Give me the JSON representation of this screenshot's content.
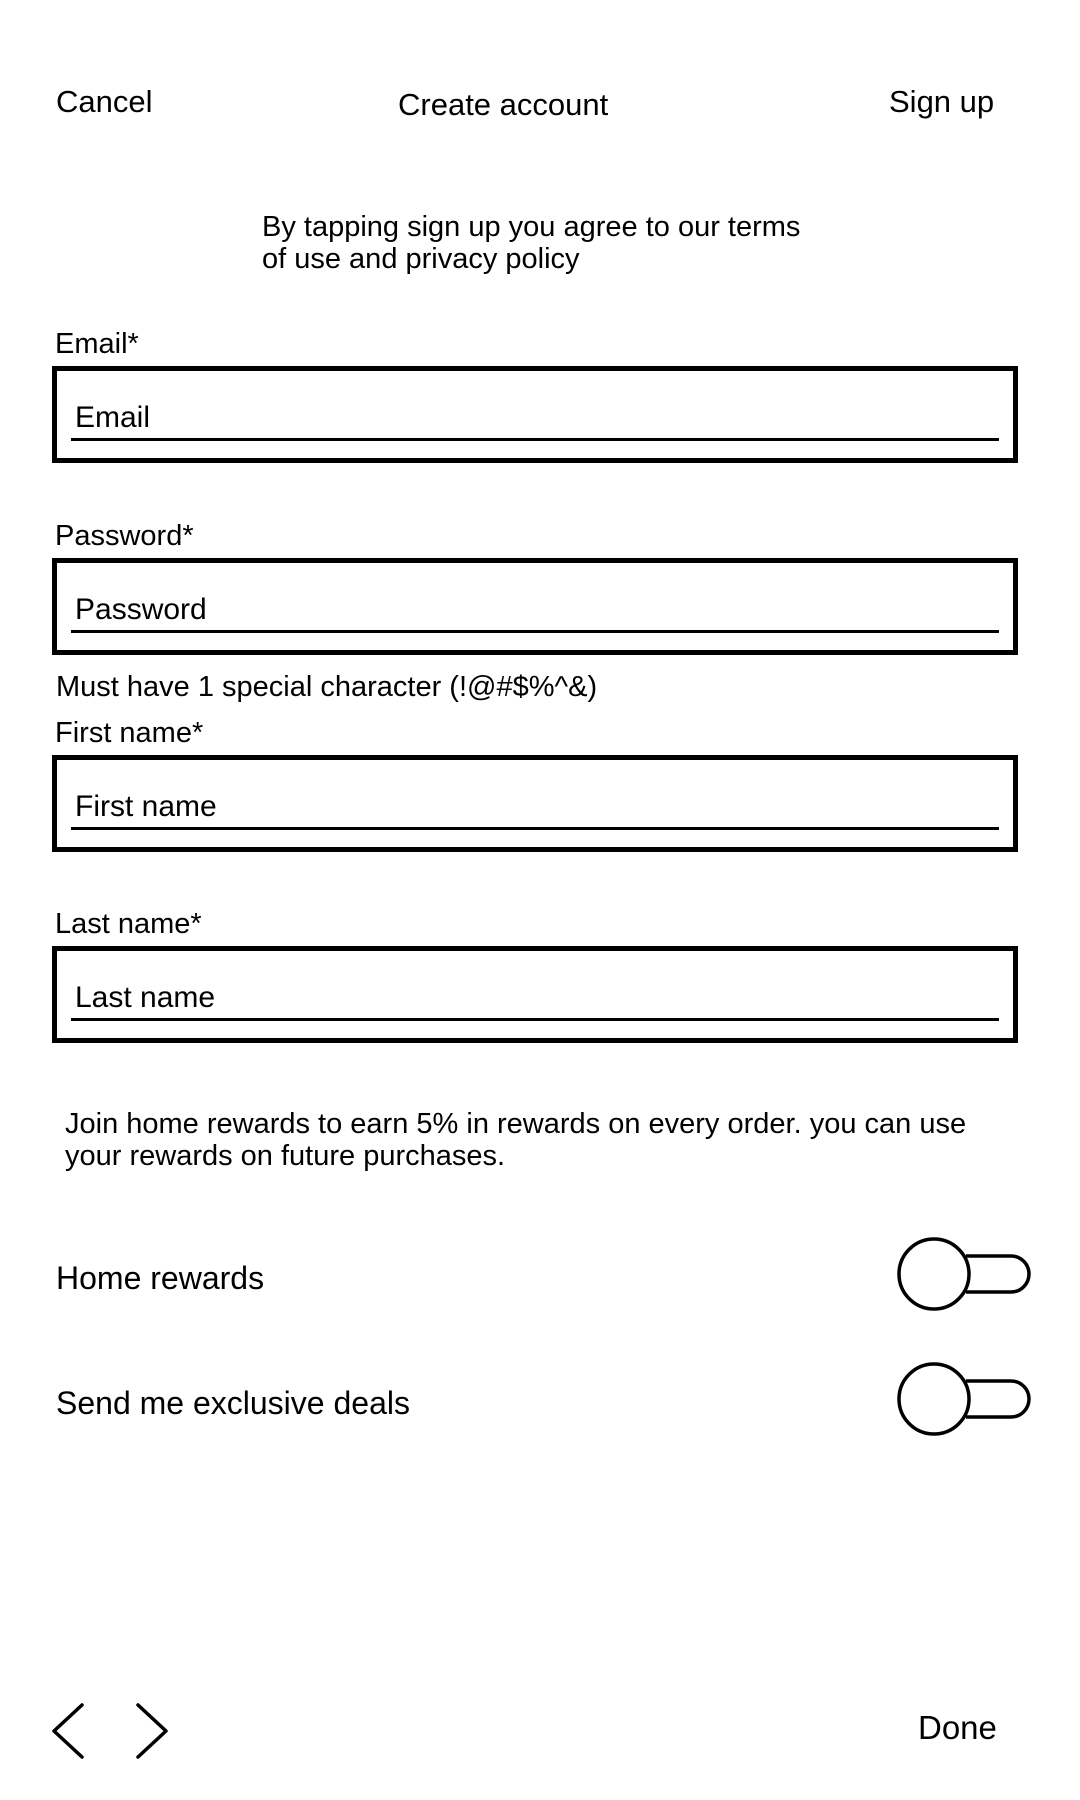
{
  "header": {
    "cancel_label": "Cancel",
    "title": "Create account",
    "signup_label": "Sign up"
  },
  "terms": {
    "line1": "By tapping sign up you agree to our terms",
    "line2": "of use and privacy policy"
  },
  "form": {
    "email": {
      "label": "Email*",
      "placeholder": "Email",
      "value": ""
    },
    "password": {
      "label": "Password*",
      "placeholder": "Password",
      "value": "",
      "hint": "Must have 1 special character (!@#$%^&)"
    },
    "first_name": {
      "label": "First name*",
      "placeholder": "First name",
      "value": ""
    },
    "last_name": {
      "label": "Last name*",
      "placeholder": "Last name",
      "value": ""
    }
  },
  "rewards_info": {
    "line1": "Join home rewards to earn 5% in rewards on every order. you can use",
    "line2": "your rewards on future purchases."
  },
  "toggles": [
    {
      "label": "Home rewards",
      "state": "off"
    },
    {
      "label": "Send me exclusive deals",
      "state": "off"
    }
  ],
  "bottom_bar": {
    "prev_icon": "chevron-left-icon",
    "next_icon": "chevron-right-icon",
    "done_label": "Done"
  },
  "colors": {
    "background": "#ffffff",
    "foreground": "#000000"
  }
}
